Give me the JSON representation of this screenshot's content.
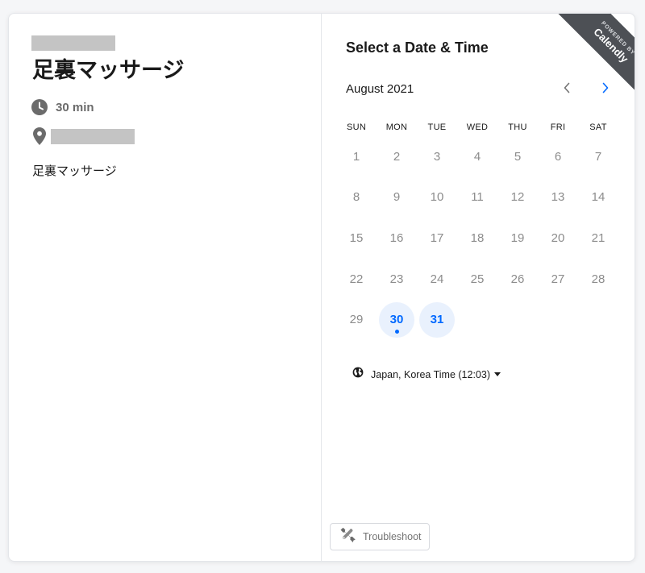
{
  "event": {
    "title": "足裏マッサージ",
    "duration": "30 min",
    "description": "足裏マッサージ"
  },
  "scheduler": {
    "title": "Select a Date & Time",
    "month_label": "August 2021",
    "weekdays": [
      "SUN",
      "MON",
      "TUE",
      "WED",
      "THU",
      "FRI",
      "SAT"
    ],
    "weeks": [
      [
        "1",
        "2",
        "3",
        "4",
        "5",
        "6",
        "7"
      ],
      [
        "8",
        "9",
        "10",
        "11",
        "12",
        "13",
        "14"
      ],
      [
        "15",
        "16",
        "17",
        "18",
        "19",
        "20",
        "21"
      ],
      [
        "22",
        "23",
        "24",
        "25",
        "26",
        "27",
        "28"
      ],
      [
        "29",
        "30",
        "31",
        "",
        "",
        "",
        ""
      ]
    ],
    "available_days": [
      "30",
      "31"
    ],
    "today": "30",
    "timezone_label": "Japan, Korea Time (12:03)"
  },
  "badge": {
    "top_text": "POWERED BY",
    "brand": "Calendly"
  },
  "troubleshoot": {
    "label": "Troubleshoot"
  },
  "icons": {
    "duration": "clock-icon",
    "location": "map-pin-icon",
    "previous_month": "chevron-left-icon",
    "next_month": "chevron-right-icon",
    "timezone": "globe-icon",
    "timezone_dropdown": "caret-down-icon",
    "troubleshoot": "wrench-icon"
  },
  "colors": {
    "accent": "#0069ff",
    "available_day_bg": "#e9f1fd",
    "badge_bg": "#4d5055",
    "muted_text": "#8c8c8c"
  }
}
